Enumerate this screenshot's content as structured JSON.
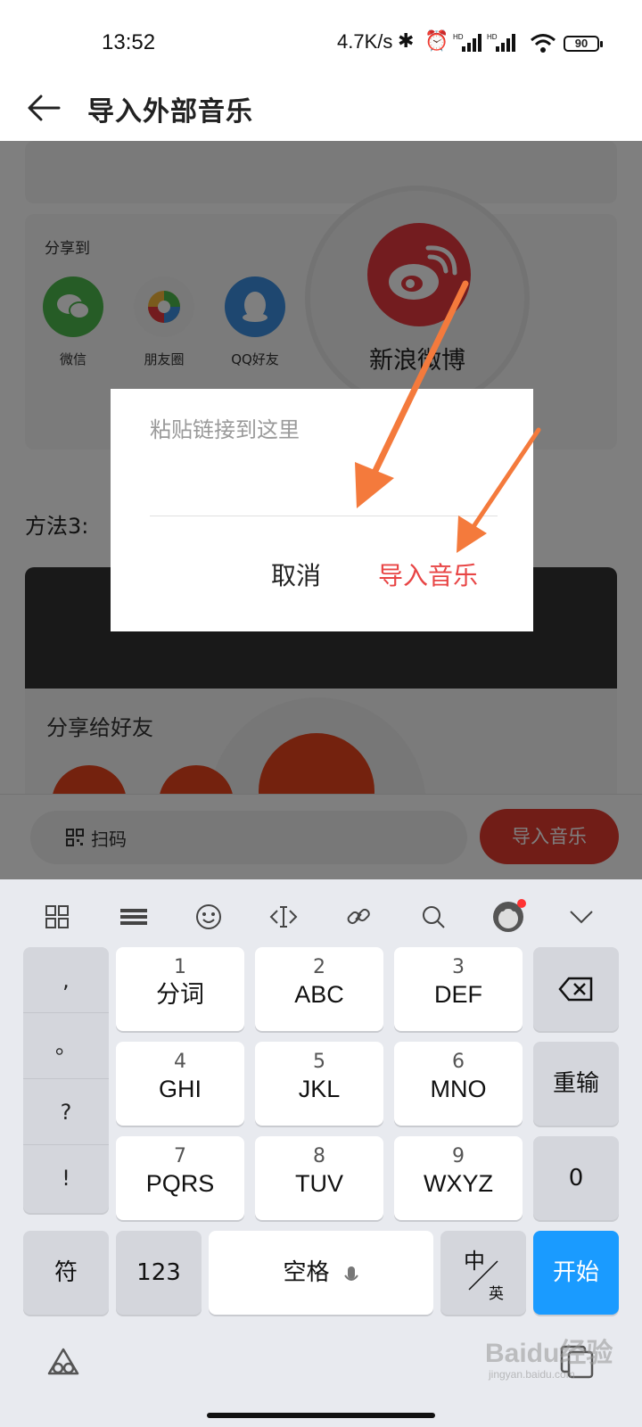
{
  "status_bar": {
    "time": "13:52",
    "speed": "4.7K/s",
    "battery": "90",
    "icons": [
      "bluetooth-icon",
      "alarm-icon",
      "hd-signal-icon",
      "hd-signal-icon",
      "wifi-icon",
      "battery-icon"
    ]
  },
  "header": {
    "title": "导入外部音乐",
    "back_icon": "back-arrow-icon"
  },
  "background": {
    "share_to_label": "分享到",
    "share_apps": [
      {
        "label": "微信",
        "icon": "wechat-icon",
        "color": "#4cb84c"
      },
      {
        "label": "朋友圈",
        "icon": "moments-icon",
        "color": "#f2f2f2"
      },
      {
        "label": "QQ好友",
        "icon": "qq-icon",
        "color": "#3d8fe0"
      }
    ],
    "weibo_label": "新浪微博",
    "method_label": "方法3:",
    "share_friends_label": "分享给好友",
    "scan_label": "扫码",
    "import_button_label": "导入音乐"
  },
  "dialog": {
    "placeholder": "粘贴链接到这里",
    "cancel_label": "取消",
    "confirm_label": "导入音乐",
    "confirm_color": "#e84545"
  },
  "keyboard": {
    "toolbar_icons": [
      "apps-grid-icon",
      "keyboard-icon",
      "emoji-icon",
      "cursor-move-icon",
      "link-icon",
      "search-icon",
      "ai-assistant-icon",
      "collapse-icon"
    ],
    "punctuation": [
      ",",
      "。",
      "?",
      "!"
    ],
    "keys": [
      {
        "num": "1",
        "letters": "分词"
      },
      {
        "num": "2",
        "letters": "ABC"
      },
      {
        "num": "3",
        "letters": "DEF"
      },
      {
        "num": "4",
        "letters": "GHI"
      },
      {
        "num": "5",
        "letters": "JKL"
      },
      {
        "num": "6",
        "letters": "MNO"
      },
      {
        "num": "7",
        "letters": "PQRS"
      },
      {
        "num": "8",
        "letters": "TUV"
      },
      {
        "num": "9",
        "letters": "WXYZ"
      }
    ],
    "reinput_label": "重输",
    "zero_label": "0",
    "symbol_label": "符",
    "number_label": "123",
    "space_label": "空格",
    "lang_top": "中",
    "lang_bottom": "英",
    "go_label": "开始",
    "accent_color": "#1a9bff"
  },
  "watermark": {
    "main": "Baidu经验",
    "sub": "jingyan.baidu.com"
  }
}
